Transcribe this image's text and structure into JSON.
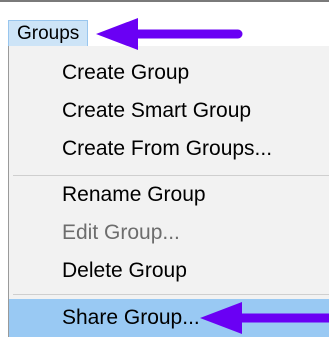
{
  "menubar": {
    "title": "Groups"
  },
  "menu": {
    "items": [
      {
        "label": "Create Group",
        "enabled": true
      },
      {
        "label": "Create Smart Group",
        "enabled": true
      },
      {
        "label": "Create From Groups...",
        "enabled": true
      },
      {
        "label": "Rename Group",
        "enabled": true
      },
      {
        "label": "Edit Group...",
        "enabled": false
      },
      {
        "label": "Delete Group",
        "enabled": true
      },
      {
        "label": "Share Group...",
        "enabled": true,
        "highlighted": true
      }
    ]
  },
  "annotations": {
    "arrow_color": "#6a00f4"
  },
  "colors": {
    "highlight": "#99c9f3",
    "title_bg": "#cde4f7"
  }
}
